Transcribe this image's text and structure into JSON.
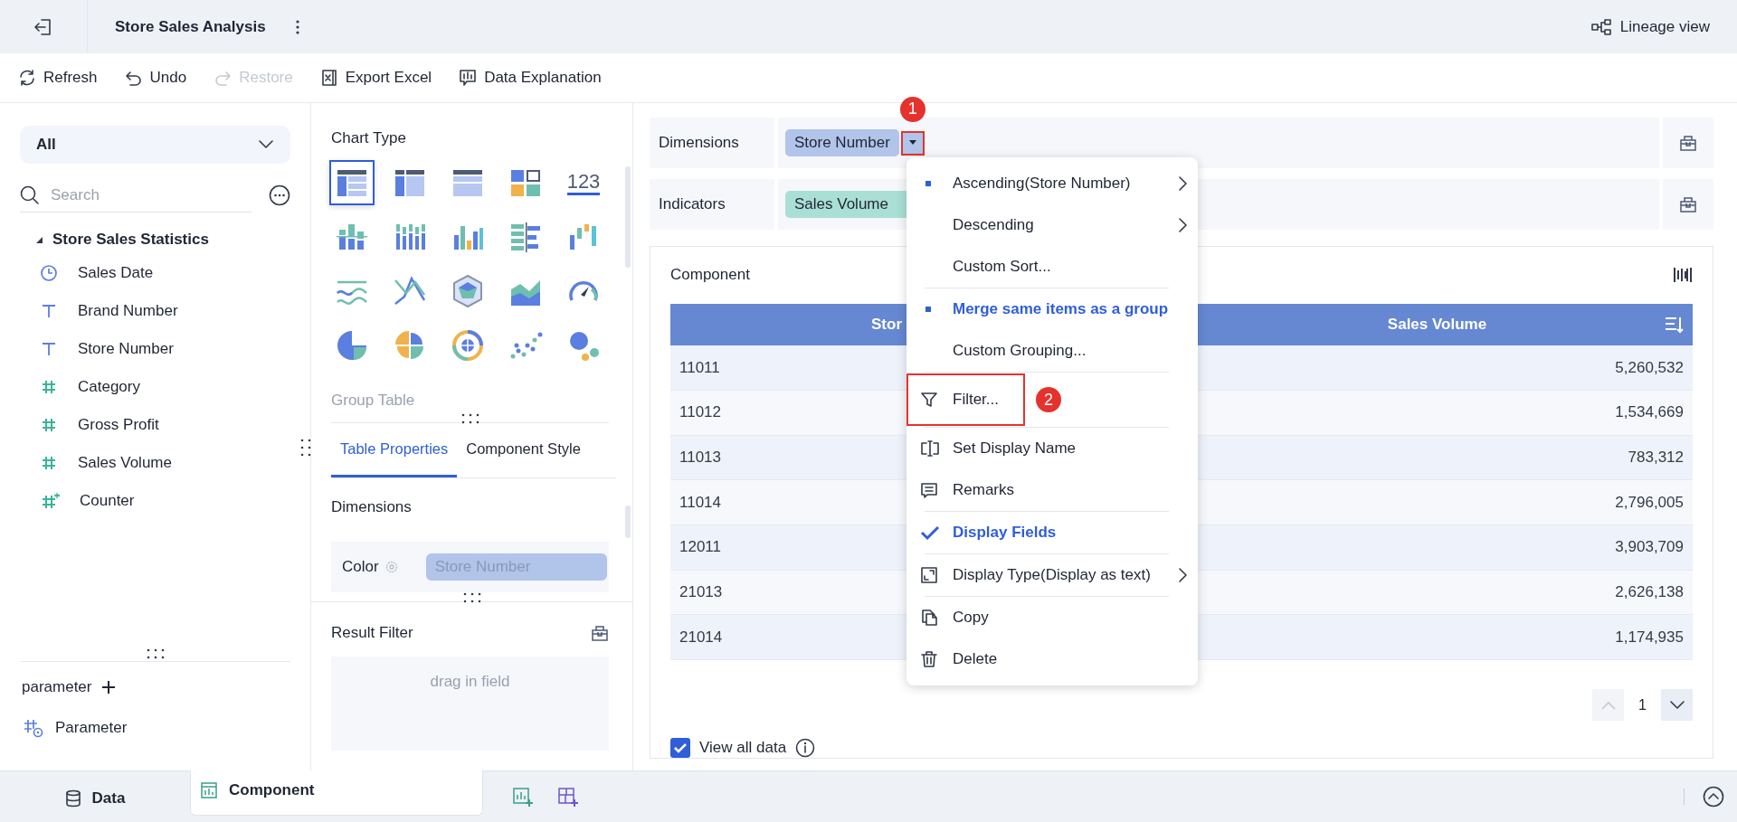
{
  "header": {
    "title": "Store Sales Analysis",
    "lineage": "Lineage view"
  },
  "toolbar": [
    {
      "label": "Refresh",
      "kind": "refresh",
      "disabled": false
    },
    {
      "label": "Undo",
      "kind": "undo",
      "disabled": false
    },
    {
      "label": "Restore",
      "kind": "redo",
      "disabled": true
    },
    {
      "label": "Export Excel",
      "kind": "excel",
      "disabled": false
    },
    {
      "label": "Data Explanation",
      "kind": "explain",
      "disabled": false
    }
  ],
  "fields_panel": {
    "scope": "All",
    "search_placeholder": "Search",
    "dataset": {
      "name": "Store Sales Statistics",
      "expanded": true,
      "children": [
        {
          "name": "Sales Date",
          "kind": "date"
        },
        {
          "name": "Brand Number",
          "kind": "text"
        },
        {
          "name": "Store Number",
          "kind": "text"
        },
        {
          "name": "Category",
          "kind": "number"
        },
        {
          "name": "Gross Profit",
          "kind": "number"
        },
        {
          "name": "Sales Volume",
          "kind": "number"
        },
        {
          "name": "Counter",
          "kind": "counter"
        }
      ]
    },
    "parameter_label": "parameter",
    "parameters": [
      {
        "name": "Parameter"
      }
    ]
  },
  "chart_panel": {
    "title": "Chart Type",
    "types": [
      {
        "kind": "group-table",
        "selected": true
      },
      {
        "kind": "cross-table",
        "selected": false
      },
      {
        "kind": "detail-table",
        "selected": false
      },
      {
        "kind": "card",
        "selected": false
      },
      {
        "kind": "number",
        "label": "123",
        "selected": false
      },
      {
        "kind": "stacked-bar",
        "selected": false
      },
      {
        "kind": "multi-bar",
        "selected": false
      },
      {
        "kind": "column",
        "selected": false
      },
      {
        "kind": "hbar",
        "selected": false
      },
      {
        "kind": "waterfall",
        "selected": false
      },
      {
        "kind": "wave",
        "selected": false
      },
      {
        "kind": "line",
        "selected": false
      },
      {
        "kind": "radar",
        "selected": false
      },
      {
        "kind": "area",
        "selected": false
      },
      {
        "kind": "gauge",
        "selected": false
      },
      {
        "kind": "pie",
        "selected": false
      },
      {
        "kind": "rose",
        "selected": false
      },
      {
        "kind": "sunburst",
        "selected": false
      },
      {
        "kind": "scatter",
        "selected": false
      },
      {
        "kind": "bubble",
        "selected": false
      }
    ],
    "selected_name": "Group Table",
    "tabs": [
      {
        "label": "Table Properties",
        "selected": true
      },
      {
        "label": "Component Style",
        "selected": false
      }
    ],
    "dimensions_label": "Dimensions",
    "color_label": "Color",
    "color_field": "Store Number",
    "result_filter": "Result Filter",
    "drop_hint": "drag in field"
  },
  "shelves": [
    {
      "label": "Dimensions",
      "chip": "Store Number",
      "kind": "dimension",
      "annotation": "1"
    },
    {
      "label": "Indicators",
      "chip": "Sales Volume",
      "kind": "indicator"
    }
  ],
  "component": {
    "title": "Component",
    "columns": [
      "Stor",
      "Sales Volume"
    ],
    "rows": [
      [
        "11011",
        "5,260,532"
      ],
      [
        "11012",
        "1,534,669"
      ],
      [
        "11013",
        "783,312"
      ],
      [
        "11014",
        "2,796,005"
      ],
      [
        "12011",
        "3,903,709"
      ],
      [
        "21013",
        "2,626,138"
      ],
      [
        "21014",
        "1,174,935"
      ]
    ],
    "page": "1",
    "view_all": {
      "label": "View all data",
      "checked": true
    }
  },
  "menu": {
    "groups": [
      {
        "items": [
          {
            "label": "Ascending(Store Number)",
            "kind": "option",
            "selected": true,
            "highlight": false,
            "submenu": true
          },
          {
            "label": "Descending",
            "kind": "option",
            "selected": false,
            "highlight": false,
            "submenu": true
          },
          {
            "label": "Custom Sort...",
            "kind": "option",
            "selected": false,
            "highlight": false,
            "submenu": false
          }
        ]
      },
      {
        "items": [
          {
            "label": "Merge same items as a group",
            "kind": "option",
            "selected": true,
            "highlight": true,
            "submenu": false
          },
          {
            "label": "Custom Grouping...",
            "kind": "option",
            "selected": false,
            "highlight": false,
            "submenu": false
          }
        ]
      },
      {
        "items": [
          {
            "label": "Filter...",
            "kind": "filter",
            "annotation": "2"
          }
        ]
      },
      {
        "items": [
          {
            "label": "Set Display Name",
            "kind": "rename"
          },
          {
            "label": "Remarks",
            "kind": "remarks"
          }
        ]
      },
      {
        "items": [
          {
            "label": "Display Fields",
            "kind": "toggle",
            "checked": true
          }
        ]
      },
      {
        "items": [
          {
            "label": "Display Type(Display as text)",
            "kind": "resize",
            "submenu": true
          }
        ]
      },
      {
        "items": [
          {
            "label": "Copy",
            "kind": "copy"
          },
          {
            "label": "Delete",
            "kind": "delete"
          }
        ]
      }
    ]
  },
  "bottom_tabs": [
    {
      "label": "Data",
      "kind": "data",
      "selected": false
    },
    {
      "label": "Component",
      "kind": "component",
      "selected": true
    }
  ]
}
